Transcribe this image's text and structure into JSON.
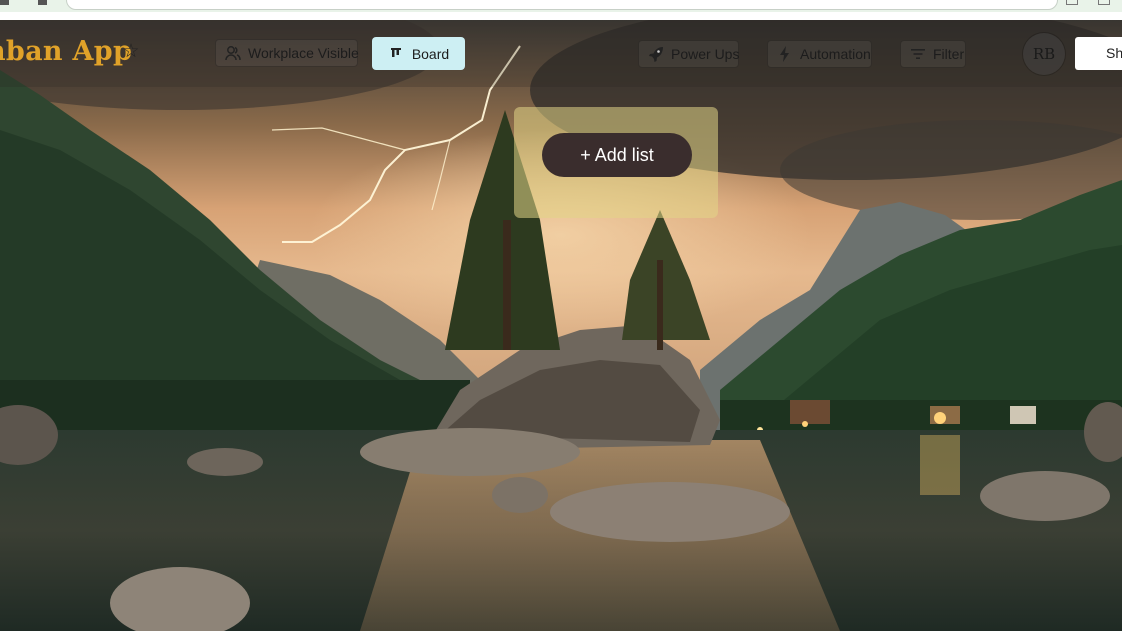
{
  "header": {
    "app_title": "nban App",
    "star_icon": "star-outline-icon",
    "workplace_label": "Workplace Visible",
    "workplace_icon": "users-icon",
    "board_label": "Board",
    "board_icon": "board-icon",
    "powerups_label": "Power Ups",
    "powerups_icon": "rocket-icon",
    "automation_label": "Automation",
    "automation_icon": "lightning-icon",
    "filter_label": "Filter",
    "filter_icon": "filter-icon",
    "avatar_initials": "RB",
    "share_label": "Share"
  },
  "board": {
    "add_list_label": "+ Add list"
  },
  "colors": {
    "title_gold": "#e0a229",
    "board_active_bg": "#cdeff3",
    "add_list_btn_bg": "#3a2d2d",
    "add_panel_bg": "#e2d686"
  }
}
